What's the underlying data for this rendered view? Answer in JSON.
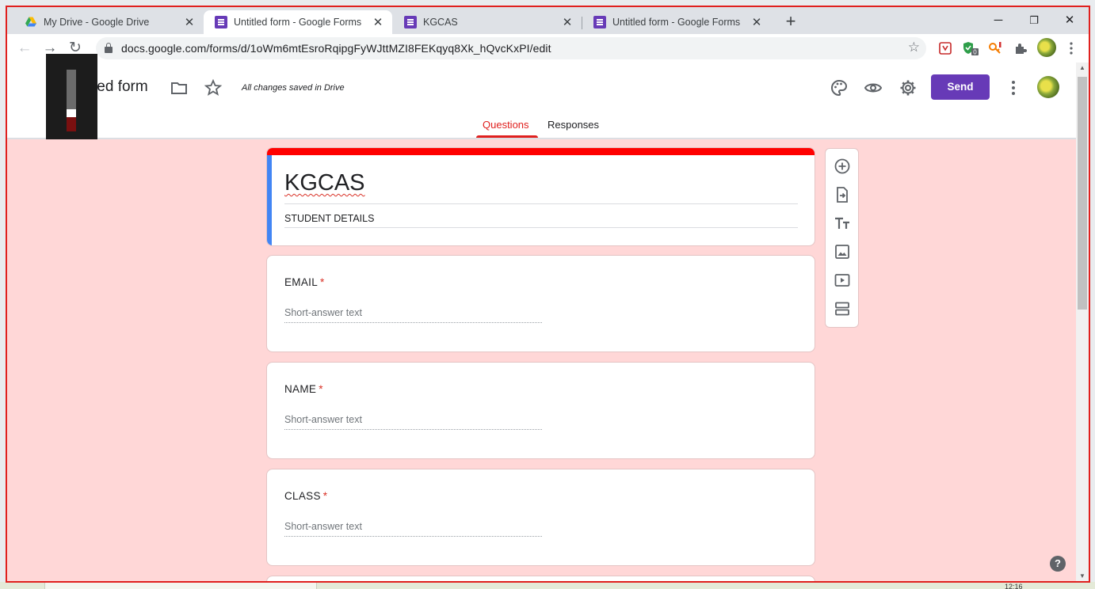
{
  "browser": {
    "tabs": [
      {
        "title": "My Drive - Google Drive",
        "icon": "google-drive-icon",
        "active": false
      },
      {
        "title": "Untitled form - Google Forms",
        "icon": "google-forms-icon",
        "active": true
      },
      {
        "title": "KGCAS",
        "icon": "google-forms-icon",
        "active": false
      },
      {
        "title": "Untitled form - Google Forms",
        "icon": "google-forms-icon",
        "active": false
      }
    ],
    "url": "docs.google.com/forms/d/1oWm6mtEsroRqipgFyWJttMZI8FEKqyq8Xk_hQvcKxPI/edit",
    "extension_badge": "0"
  },
  "forms_header": {
    "form_title": "Untitled form",
    "saved_status": "All changes saved in Drive",
    "send_label": "Send",
    "tabs": {
      "questions": "Questions",
      "responses": "Responses"
    }
  },
  "overlay": {
    "value": "26"
  },
  "form": {
    "title": "KGCAS",
    "description": "STUDENT DETAILS",
    "questions": [
      {
        "label": "EMAIL",
        "required_mark": "*",
        "placeholder": "Short-answer text"
      },
      {
        "label": "NAME",
        "required_mark": "*",
        "placeholder": "Short-answer text"
      },
      {
        "label": "CLASS",
        "required_mark": "*",
        "placeholder": "Short-answer text"
      }
    ]
  },
  "colors": {
    "accent": "#673ab7",
    "theme_red": "#ff0000",
    "background": "#ffd7d7",
    "left_bar": "#4285f4"
  },
  "taskbar": {
    "clock": "12:16"
  }
}
